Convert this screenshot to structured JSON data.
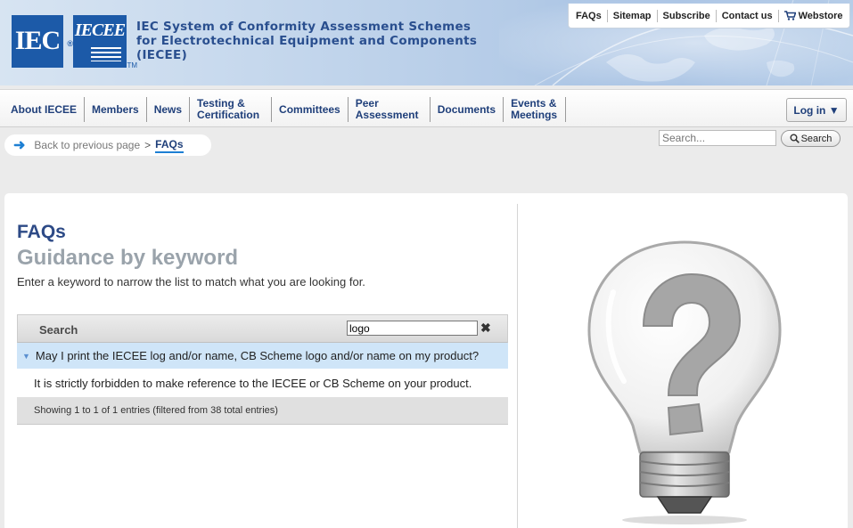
{
  "header": {
    "logo_iec": "IEC",
    "logo_iecee": "IECEE",
    "org_title": "IEC System of Conformity Assessment Schemes for Electrotechnical Equipment and Components (IECEE)",
    "top_links": [
      "FAQs",
      "Sitemap",
      "Subscribe",
      "Contact us",
      "Webstore"
    ],
    "webstore_icon": "cart-icon"
  },
  "nav": {
    "items": [
      "About IECEE",
      "Members",
      "News",
      "Testing & Certification",
      "Committees",
      "Peer Assessment",
      "Documents",
      "Events & Meetings"
    ],
    "login": "Log in ▼"
  },
  "breadcrumb": {
    "back": "Back to previous page",
    "separator": ">",
    "current": "FAQs"
  },
  "site_search": {
    "placeholder": "Search...",
    "button": "Search"
  },
  "content": {
    "title": "FAQs",
    "subtitle": "Guidance by keyword",
    "intro": "Enter a keyword to narrow the list to match what you are looking for.",
    "table": {
      "search_label": "Search",
      "filter_value": "logo",
      "rows": [
        {
          "question": "May I print the IECEE log and/or name, CB Scheme logo and/or name on my product?",
          "answer": "It is strictly forbidden to make reference to the IECEE or CB Scheme on your product."
        }
      ],
      "footer": "Showing 1 to 1 of 1 entries (filtered from 38 total entries)"
    }
  },
  "colors": {
    "brand_blue": "#1c5aa8",
    "nav_text": "#2d4a86",
    "row_highlight": "#cfe5f8"
  }
}
